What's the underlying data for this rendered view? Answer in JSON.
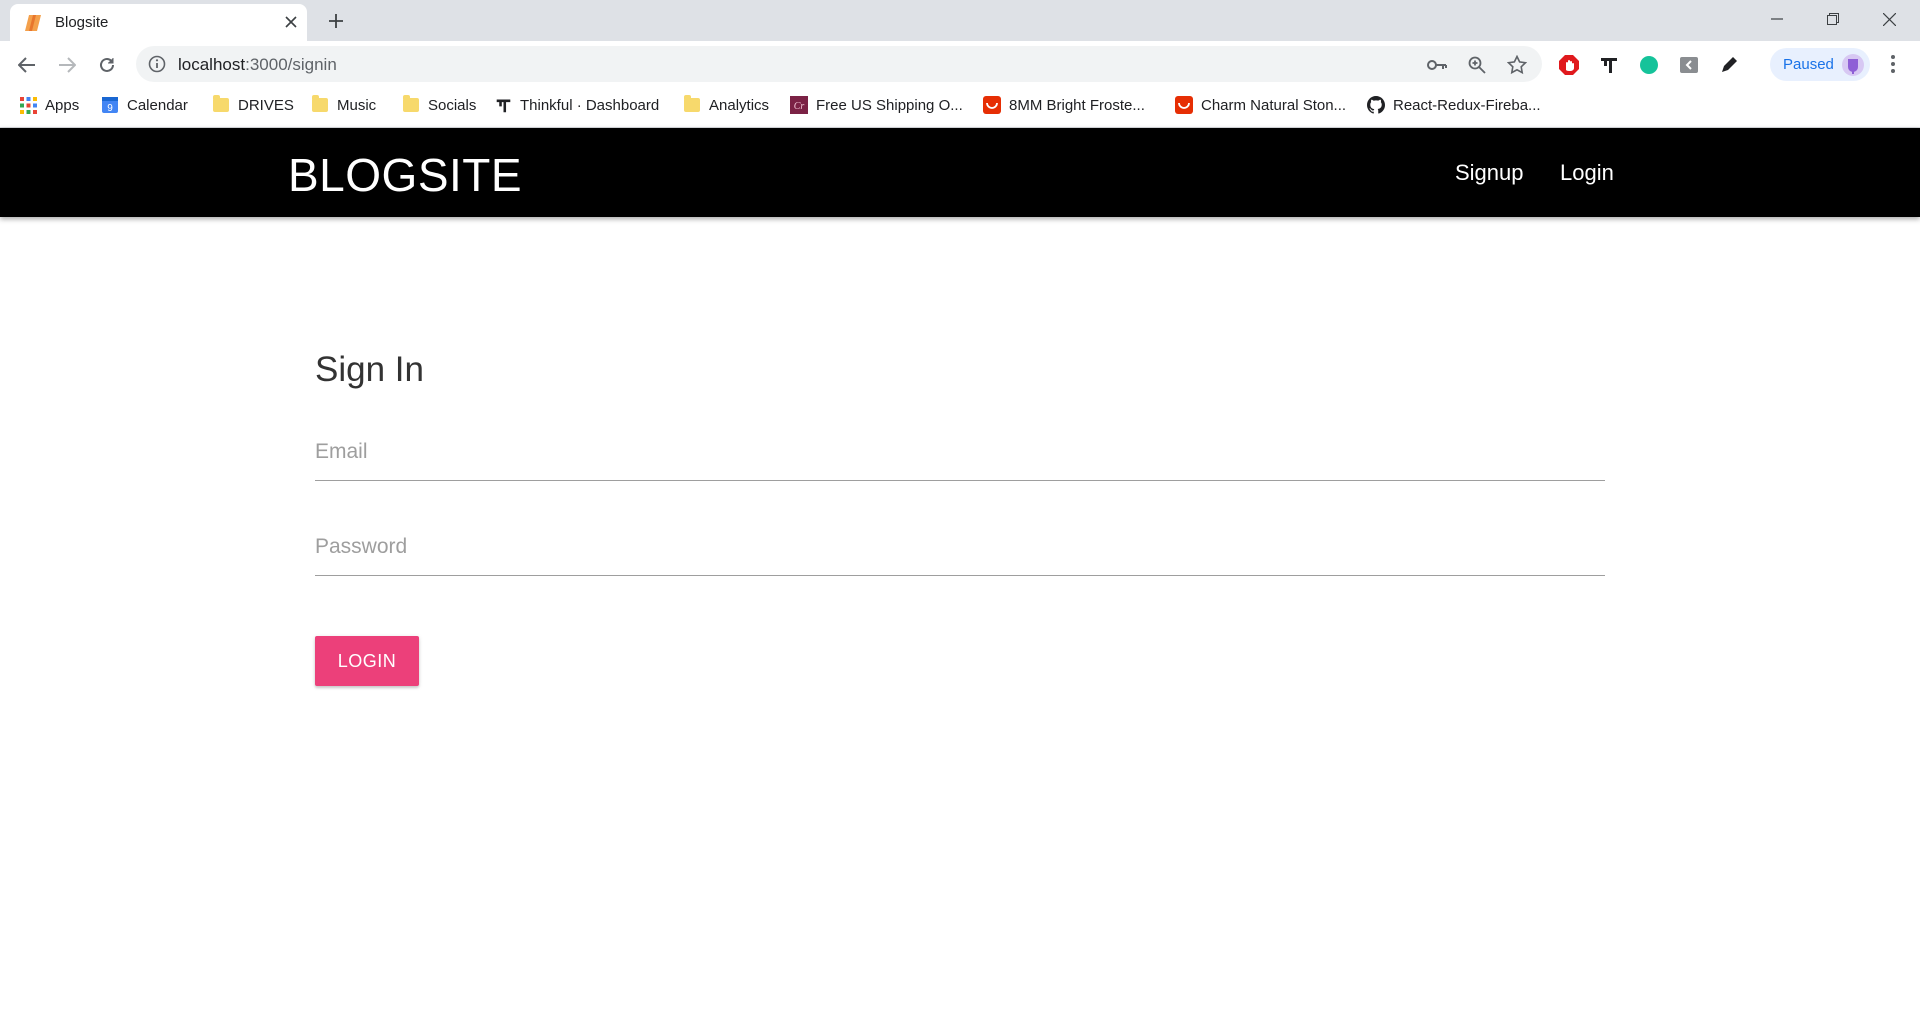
{
  "browser": {
    "tab": {
      "title": "Blogsite"
    },
    "address": {
      "host": "localhost",
      "path": ":3000/signin"
    },
    "profile": {
      "status": "Paused"
    }
  },
  "bookmarks": [
    {
      "label": "Apps",
      "icon": "apps-grid-icon"
    },
    {
      "label": "Calendar",
      "icon": "calendar-icon"
    },
    {
      "label": "DRIVES",
      "icon": "folder-icon"
    },
    {
      "label": "Music",
      "icon": "folder-icon"
    },
    {
      "label": "Socials",
      "icon": "folder-icon"
    },
    {
      "label": "Thinkful · Dashboard",
      "icon": "thinkful-icon"
    },
    {
      "label": "Analytics",
      "icon": "folder-icon"
    },
    {
      "label": "Free US Shipping O...",
      "icon": "cr-icon"
    },
    {
      "label": "8MM Bright Froste...",
      "icon": "aliexpress-icon"
    },
    {
      "label": "Charm Natural Ston...",
      "icon": "aliexpress-icon"
    },
    {
      "label": "React-Redux-Fireba...",
      "icon": "github-icon"
    }
  ],
  "site": {
    "brand": "BLOGSITE",
    "nav": {
      "signup": "Signup",
      "login": "Login"
    }
  },
  "signin": {
    "title": "Sign In",
    "email_placeholder": "Email",
    "password_placeholder": "Password",
    "button_label": "LOGIN"
  },
  "colors": {
    "navbar_bg": "#000000",
    "button_bg": "#ec407a",
    "chrome_tabstrip": "#dee1e6"
  }
}
